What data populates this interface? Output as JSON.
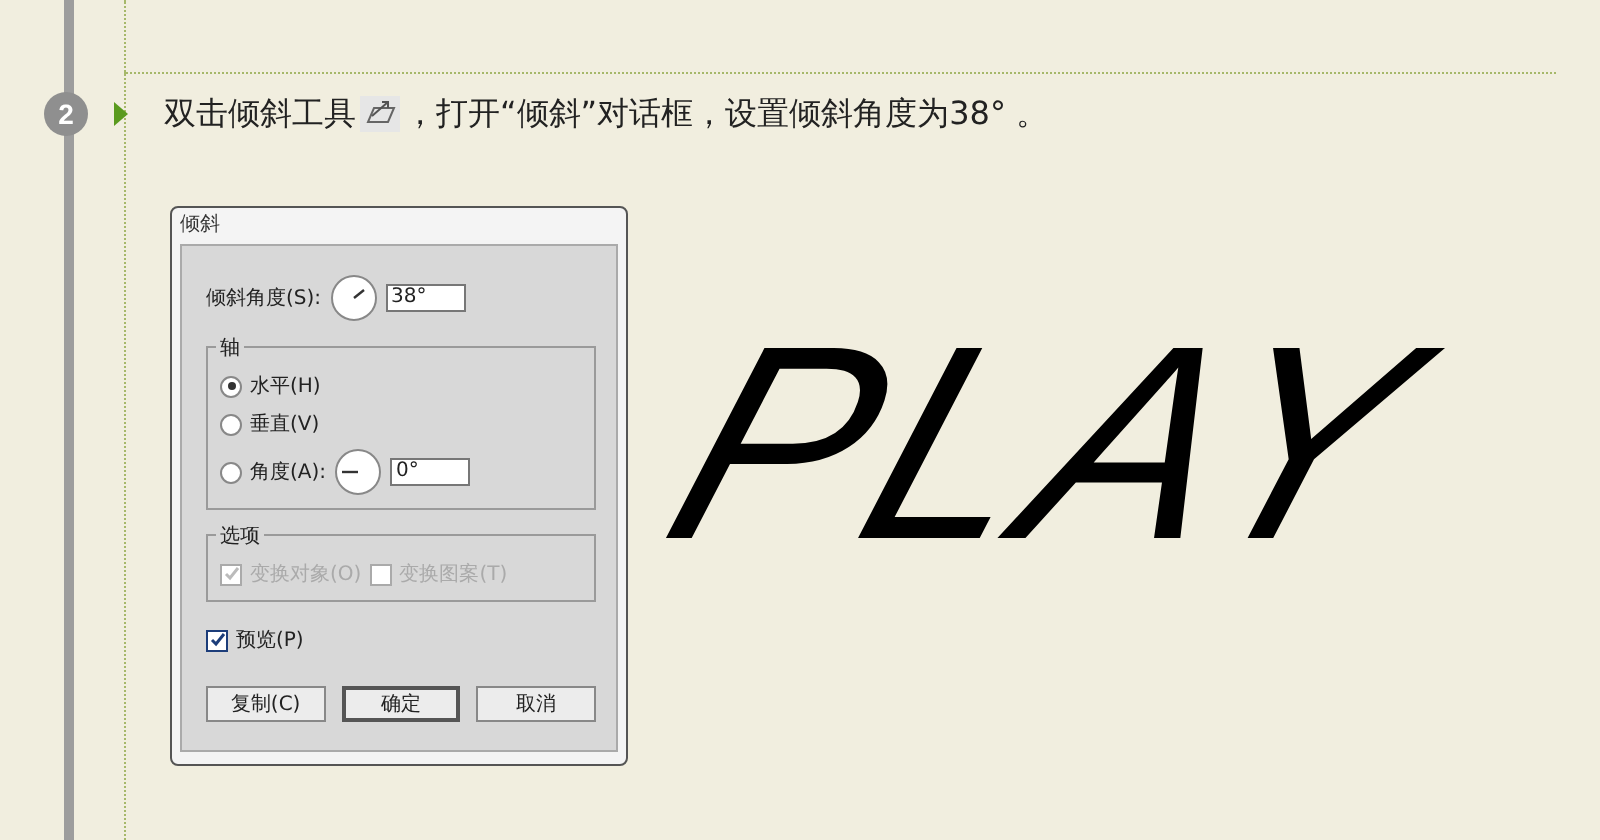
{
  "step": {
    "number": "2",
    "instruction_before": "双击倾斜工具",
    "instruction_after": "，打开“倾斜”对话框，设置倾斜角度为38° 。"
  },
  "dialog": {
    "title": "倾斜",
    "shear_angle": {
      "label": "倾斜角度(S):",
      "value": "38°"
    },
    "axis": {
      "legend": "轴",
      "options": [
        {
          "label": "水平(H)",
          "selected": true,
          "kind": "plain"
        },
        {
          "label": "垂直(V)",
          "selected": false,
          "kind": "plain"
        },
        {
          "label": "角度(A):",
          "selected": false,
          "kind": "angle",
          "value": "0°"
        }
      ]
    },
    "options": {
      "legend": "选项",
      "items": [
        {
          "label": "变换对象(O)",
          "checked": true,
          "disabled": true
        },
        {
          "label": "变换图案(T)",
          "checked": false,
          "disabled": true
        }
      ]
    },
    "preview": {
      "label": "预览(P)",
      "checked": true
    },
    "buttons": [
      {
        "label": "复制(C)",
        "default": false
      },
      {
        "label": "确定",
        "default": true
      },
      {
        "label": "取消",
        "default": false
      }
    ]
  },
  "sample_text": "PLAY"
}
